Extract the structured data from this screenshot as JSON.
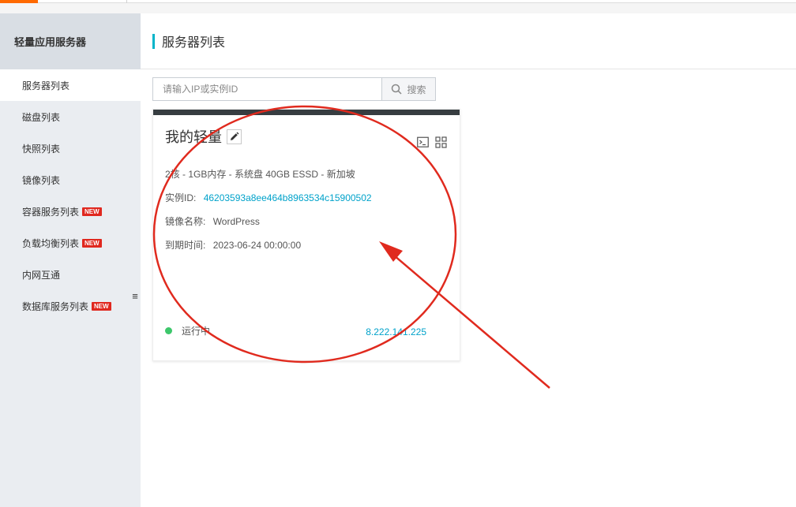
{
  "sidebar": {
    "title": "轻量应用服务器",
    "items": [
      {
        "label": "服务器列表",
        "active": true,
        "new": false
      },
      {
        "label": "磁盘列表",
        "active": false,
        "new": false
      },
      {
        "label": "快照列表",
        "active": false,
        "new": false
      },
      {
        "label": "镜像列表",
        "active": false,
        "new": false
      },
      {
        "label": "容器服务列表",
        "active": false,
        "new": true
      },
      {
        "label": "负载均衡列表",
        "active": false,
        "new": true
      },
      {
        "label": "内网互通",
        "active": false,
        "new": false
      },
      {
        "label": "数据库服务列表",
        "active": false,
        "new": true
      }
    ],
    "new_badge": "NEW",
    "collapse_icon": "≡"
  },
  "page": {
    "title": "服务器列表"
  },
  "search": {
    "placeholder": "请输入IP或实例ID",
    "button_label": "搜索"
  },
  "card": {
    "name": "我的轻量",
    "spec": "2核 - 1GB内存 - 系统盘 40GB ESSD - 新加坡",
    "instance_id_label": "实例ID:",
    "instance_id": "46203593a8ee464b8963534c15900502",
    "image_label": "镜像名称:",
    "image": "WordPress",
    "expire_label": "到期时间:",
    "expire": "2023-06-24 00:00:00",
    "status": "运行中",
    "ip": "8.222.141.225"
  },
  "colors": {
    "accent": "#ff6a00",
    "teal": "#00b4c9",
    "link": "#00a2ca",
    "running": "#3dc76b",
    "badge": "#e0281f",
    "annotation": "#e02a1e"
  },
  "icons": [
    "search-icon",
    "edit-icon",
    "terminal-icon",
    "grid-icon",
    "collapse-icon"
  ]
}
